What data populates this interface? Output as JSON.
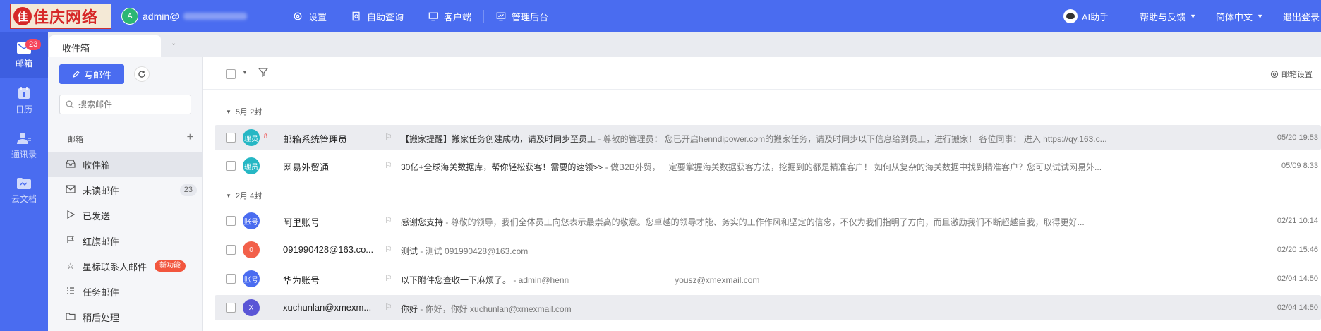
{
  "topbar": {
    "logo_mark": "佳",
    "logo_text": "佳庆网络",
    "user_initial": "A",
    "user_name": "admin@",
    "nav": [
      {
        "label": "设置",
        "icon": "gear-icon"
      },
      {
        "label": "自助查询",
        "icon": "search-doc-icon"
      },
      {
        "label": "客户端",
        "icon": "monitor-icon"
      },
      {
        "label": "管理后台",
        "icon": "dashboard-icon"
      }
    ],
    "ai_label": "AI助手",
    "help_label": "帮助与反馈",
    "lang_label": "简体中文",
    "logout_label": "退出登录"
  },
  "rail": [
    {
      "label": "邮箱",
      "icon": "mail-icon",
      "badge": "23",
      "active": true
    },
    {
      "label": "日历",
      "icon": "calendar-icon"
    },
    {
      "label": "通讯录",
      "icon": "contacts-icon"
    },
    {
      "label": "云文档",
      "icon": "folder-icon"
    }
  ],
  "tab": {
    "label": "收件箱"
  },
  "sidebar": {
    "compose_label": "写邮件",
    "search_placeholder": "搜索邮件",
    "section_label": "邮箱",
    "folders": [
      {
        "label": "收件箱",
        "icon": "inbox-icon",
        "active": true
      },
      {
        "label": "未读邮件",
        "icon": "unread-icon",
        "count": "23"
      },
      {
        "label": "已发送",
        "icon": "send-icon"
      },
      {
        "label": "红旗邮件",
        "icon": "flag-icon"
      },
      {
        "label": "星标联系人邮件",
        "icon": "star-icon",
        "badge": "新功能"
      },
      {
        "label": "任务邮件",
        "icon": "tasklist-icon"
      },
      {
        "label": "稍后处理",
        "icon": "folder-icon"
      }
    ]
  },
  "toolbar": {
    "settings_label": "邮箱设置"
  },
  "groups": [
    {
      "label": "5月 2封"
    },
    {
      "label": "2月 4封"
    }
  ],
  "emails": [
    {
      "avatar": "理员",
      "avatar_color": "#26b7c4",
      "tag": "8",
      "sender": "邮箱系统管理员",
      "subject": "【搬家提醒】搬家任务创建成功，请及时同步至员工",
      "preview": " - 尊敬的管理员：  您已开启henndipower.com的搬家任务，请及时同步以下信息给到员工，进行搬家！  各位同事：  进入 https://qy.163.c...",
      "date": "05/20 19:53",
      "selected": true
    },
    {
      "avatar": "理员",
      "avatar_color": "#26b7c4",
      "sender": "网易外贸通",
      "subject": "30亿+全球海关数据库，帮你轻松获客！需要的速领>>",
      "preview": " - 做B2B外贸，一定要掌握海关数据获客方法，挖掘到的都是精准客户！   如何从复杂的海关数据中找到精准客户？您可以试试网易外...",
      "date": "05/09 8:33"
    },
    {
      "avatar": "账号",
      "avatar_color": "#4a6cf0",
      "sender": "阿里账号",
      "subject": "感谢您支持",
      "preview": " - 尊敬的领导，我们全体员工向您表示最崇高的敬意。您卓越的领导才能、务实的工作作风和坚定的信念，不仅为我们指明了方向，而且激励我们不断超越自我，取得更好...",
      "date": "02/21 10:14"
    },
    {
      "avatar": "0",
      "avatar_color": "#f2604a",
      "sender": "091990428@163.co...",
      "subject": "测试",
      "preview": " - 测试 091990428@163.com",
      "date": "02/20 15:46"
    },
    {
      "avatar": "账号",
      "avatar_color": "#4a6cf0",
      "sender": "华为账号",
      "subject": "以下附件您查收一下麻烦了。",
      "preview_a": " - admin@henn",
      "preview_b": "yousz@xmexmail.com",
      "date": "02/04 14:50"
    },
    {
      "avatar": "X",
      "avatar_color": "#5a55d6",
      "sender": "xuchunlan@xmexm...",
      "subject": "你好",
      "preview": " - 你好，你好 xuchunlan@xmexmail.com",
      "date": "02/04 14:50",
      "selected": true
    }
  ]
}
